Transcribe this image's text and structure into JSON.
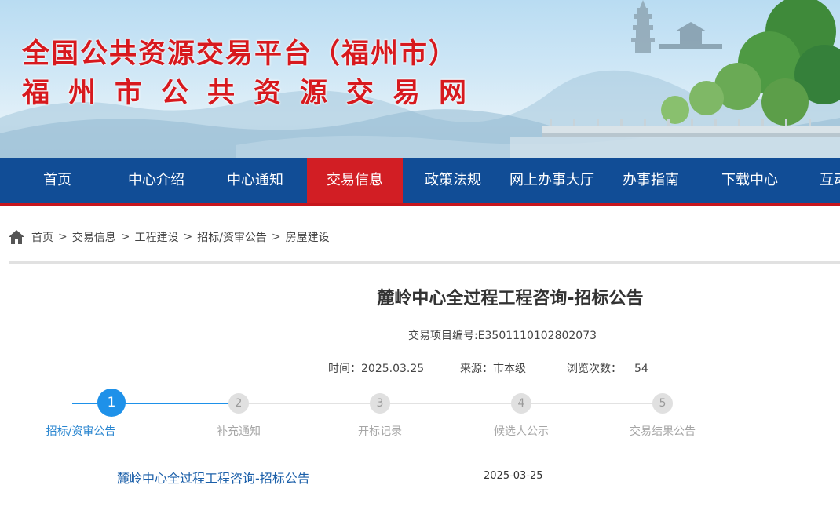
{
  "site": {
    "title_line1": "全国公共资源交易平台（福州市）",
    "title_line2": "福州市公共资源交易网"
  },
  "nav": {
    "items": [
      {
        "label": "首页",
        "active": false
      },
      {
        "label": "中心介绍",
        "active": false
      },
      {
        "label": "中心通知",
        "active": false
      },
      {
        "label": "交易信息",
        "active": true
      },
      {
        "label": "政策法规",
        "active": false
      },
      {
        "label": "网上办事大厅",
        "active": false
      },
      {
        "label": "办事指南",
        "active": false
      },
      {
        "label": "下载中心",
        "active": false
      },
      {
        "label": "互动",
        "active": false
      }
    ]
  },
  "breadcrumb": {
    "icon": "home-icon",
    "items": [
      "首页",
      "交易信息",
      "工程建设",
      "招标/资审公告",
      "房屋建设"
    ],
    "separator": ">"
  },
  "article": {
    "title": "麓岭中心全过程工程咨询-招标公告",
    "code_label": "交易项目编号:",
    "code_value": "E3501110102802073",
    "time_label": "时间：",
    "time_value": "2025.03.25",
    "source_label": "来源：",
    "source_value": "市本级",
    "views_label": "浏览次数：",
    "views_value": "54"
  },
  "steps": {
    "active_index": 0,
    "items": [
      {
        "number": "1",
        "label": "招标/资审公告"
      },
      {
        "number": "2",
        "label": "补充通知"
      },
      {
        "number": "3",
        "label": "开标记录"
      },
      {
        "number": "4",
        "label": "候选人公示"
      },
      {
        "number": "5",
        "label": "交易结果公告"
      }
    ]
  },
  "documents": [
    {
      "title": "麓岭中心全过程工程咨询-招标公告",
      "date": "2025-03-25"
    }
  ],
  "colors": {
    "nav_bg": "#114d96",
    "nav_active": "#d21e24",
    "title_red": "#d7191e",
    "step_active": "#1e91e9",
    "link_blue": "#1b5fa9"
  }
}
